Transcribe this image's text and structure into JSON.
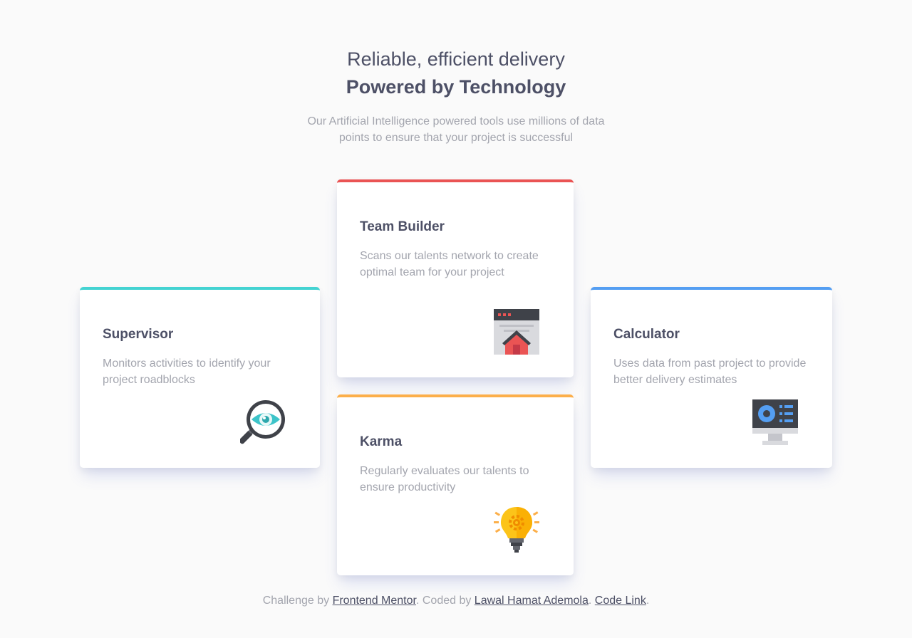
{
  "header": {
    "subtitle": "Reliable, efficient delivery",
    "title": "Powered by Technology",
    "description": "Our Artificial Intelligence powered tools use millions of data points to ensure that your project is successful"
  },
  "cards": {
    "supervisor": {
      "title": "Supervisor",
      "description": "Monitors activities to identify your project roadblocks",
      "accent": "#44d3d2",
      "icon": "magnifier-eye-icon"
    },
    "team_builder": {
      "title": "Team Builder",
      "description": "Scans our talents network to create optimal team for your project",
      "accent": "#ea5454",
      "icon": "browser-house-icon"
    },
    "karma": {
      "title": "Karma",
      "description": "Regularly evaluates our talents to ensure productivity",
      "accent": "#fcaf4a",
      "icon": "lightbulb-icon"
    },
    "calculator": {
      "title": "Calculator",
      "description": "Uses data from past project to provide better delivery estimates",
      "accent": "#549ef2",
      "icon": "monitor-dashboard-icon"
    }
  },
  "footer": {
    "prefix": "Challenge by ",
    "mentor_link": "Frontend Mentor",
    "middle": ". Coded by ",
    "author_link": "Lawal Hamat Ademola",
    "separator": ". ",
    "code_link": "Code Link",
    "suffix": "."
  }
}
